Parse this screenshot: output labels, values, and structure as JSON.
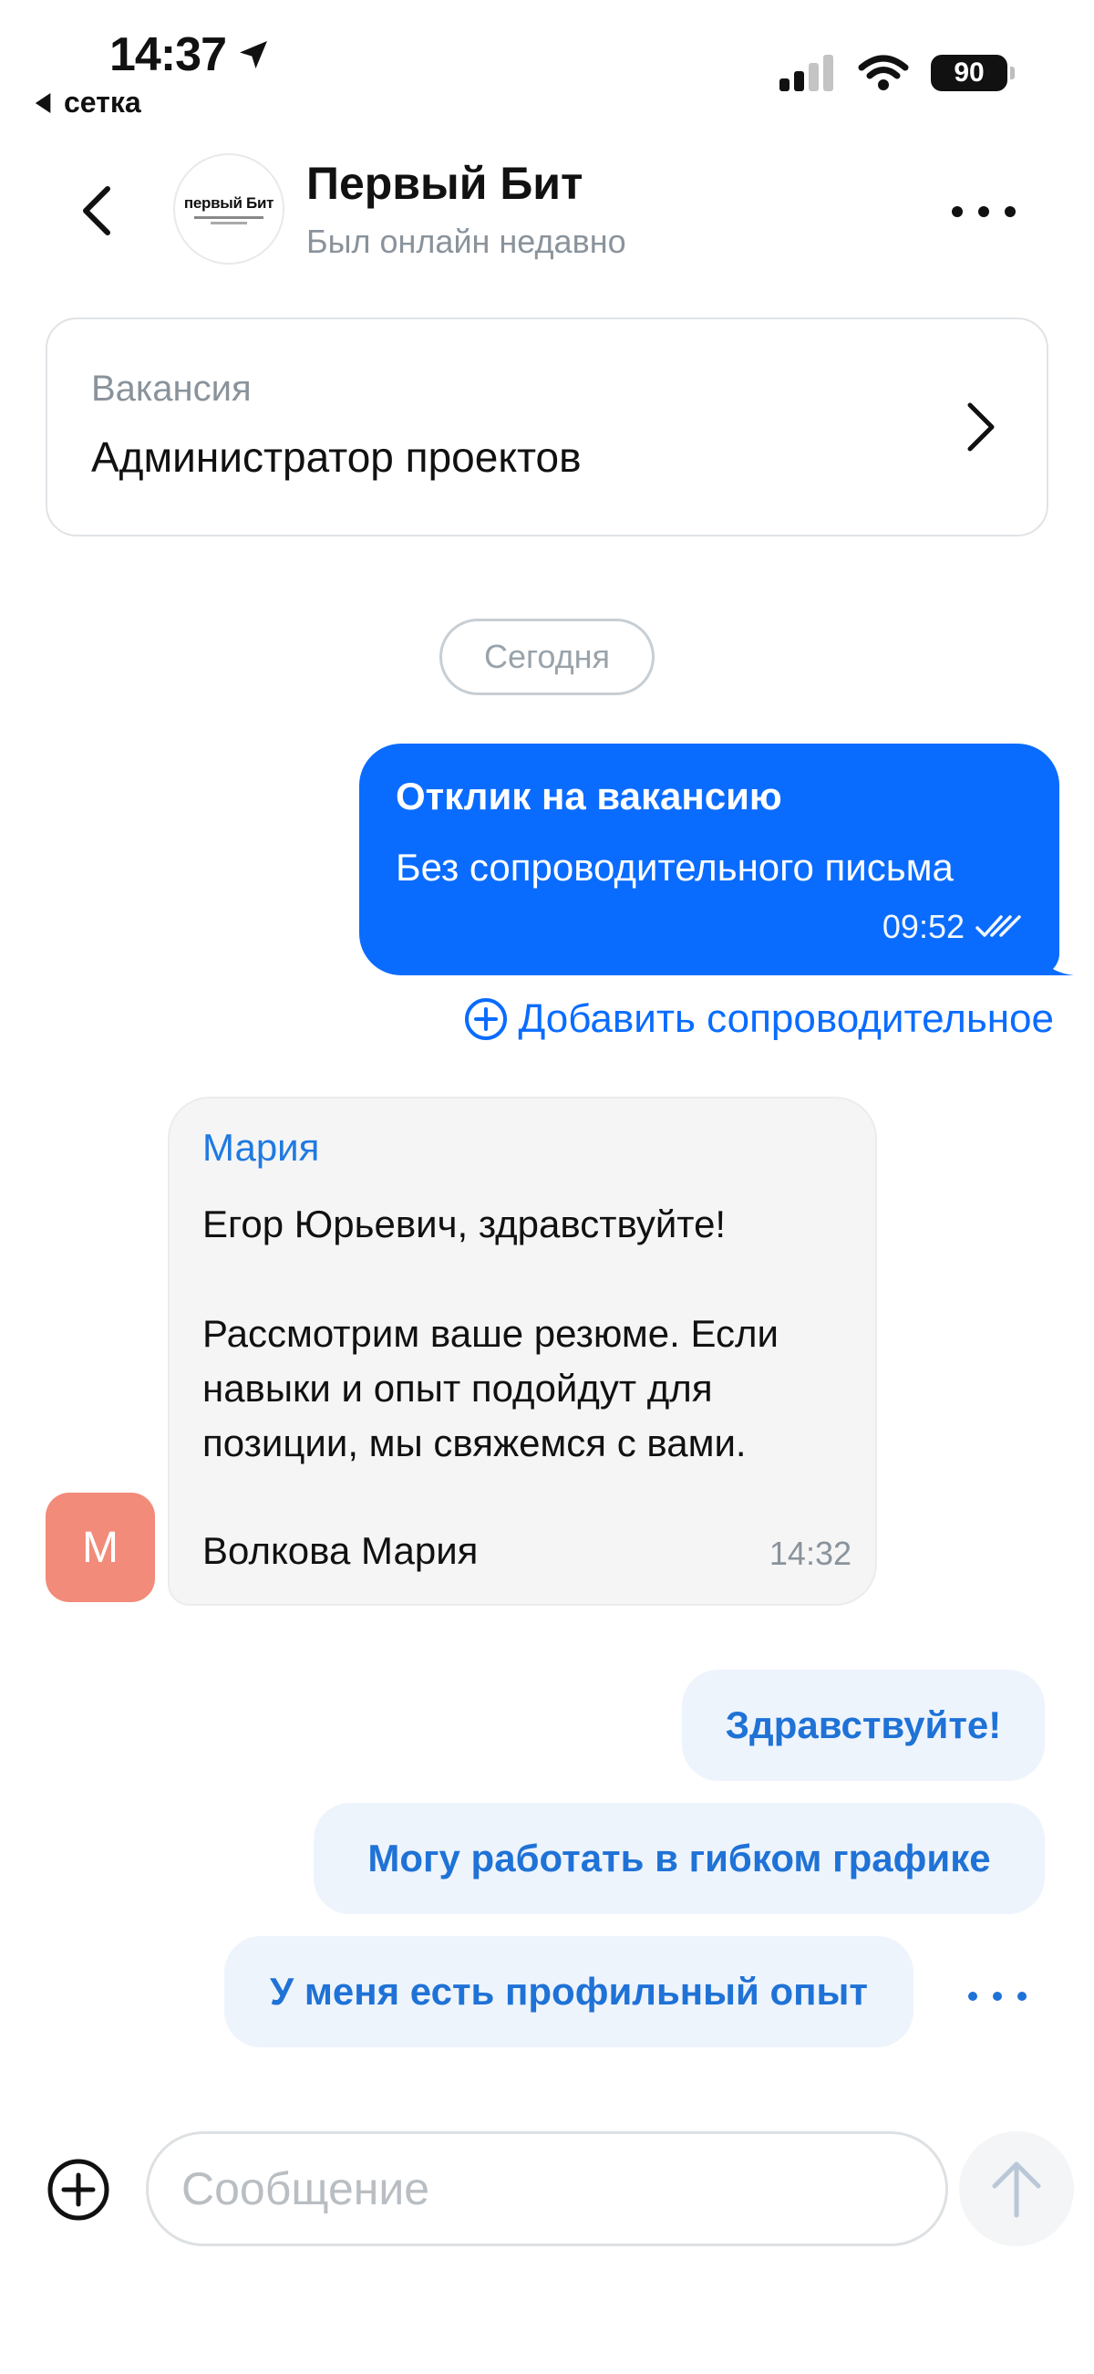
{
  "status_bar": {
    "time": "14:37",
    "back_app": "сетка",
    "battery": "90"
  },
  "header": {
    "company_name": "Первый Бит",
    "status": "Был онлайн недавно",
    "logo_text": "первый Бит"
  },
  "vacancy": {
    "label": "Вакансия",
    "title": "Администратор проектов"
  },
  "date_divider": "Сегодня",
  "outgoing_message": {
    "title": "Отклик на вакансию",
    "text": "Без сопроводительного письма",
    "time": "09:52"
  },
  "add_cover_letter": "Добавить сопроводительное",
  "incoming_message": {
    "avatar_letter": "М",
    "sender": "Мария",
    "text": "Егор Юрьевич, здравствуйте!\n\nРассмотрим ваше резюме. Если навыки и опыт подойдут для позиции, мы свяжемся с вами.",
    "signature": "Волкова Мария",
    "time": "14:32",
    "avatar_color": "#f28b7a"
  },
  "quick_replies": [
    "Здравствуйте!",
    "Могу работать в гибком графике",
    "У меня есть профильный опыт"
  ],
  "composer": {
    "placeholder": "Сообщение"
  },
  "colors": {
    "accent": "#0a6cff",
    "link": "#1f72d6",
    "quick_bg": "#eef4fc"
  }
}
